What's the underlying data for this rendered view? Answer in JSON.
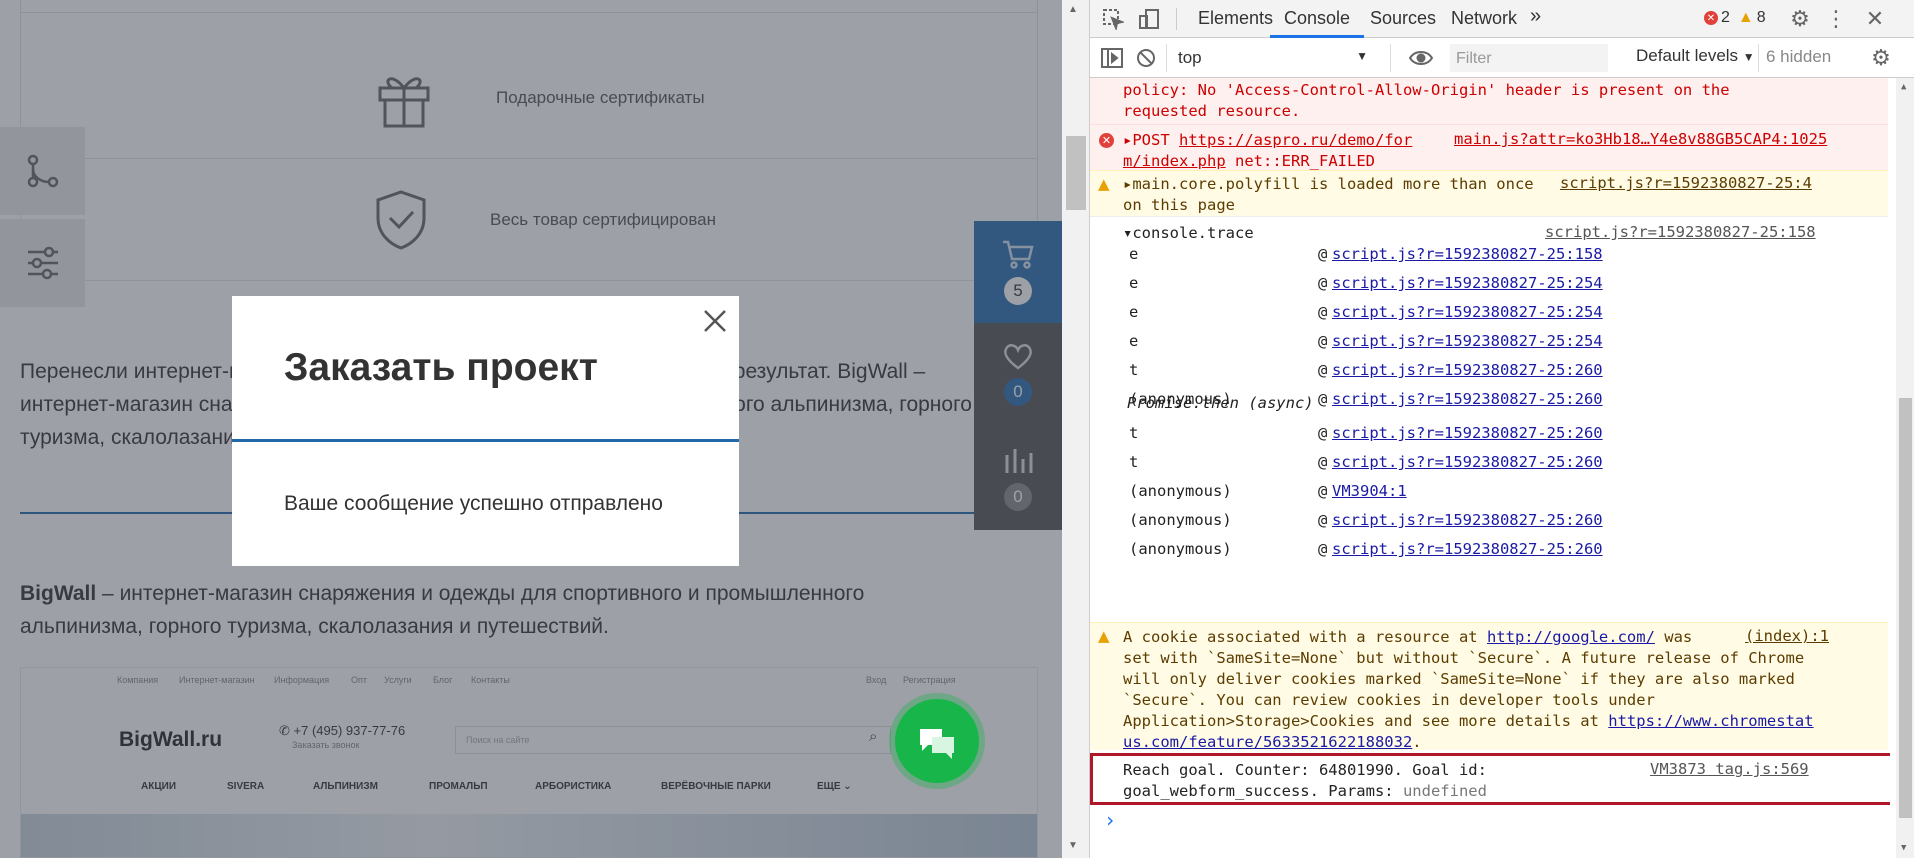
{
  "page": {
    "features": [
      {
        "label": "Подарочные сертификаты",
        "icon": "gift-icon"
      },
      {
        "label": "Весь товар сертифицирован",
        "icon": "shield-check-icon"
      }
    ],
    "intro_text": "Перенесли интернет-магазин на Аспро: Максимум и получили отличный результат. BigWall – интернет-магазин снаряжения и одежды для спортивного и промышленного альпинизма, горного туризма, скалолазания и путешествий.",
    "brand_bold": "BigWall",
    "brand_text": " – интернет-магазин снаряжения и одежды для спортивного и промышленного альпинизма, горного туризма, скалолазания и путешествий.",
    "screenshot": {
      "top_links": [
        "Компания",
        "Интернет-магазин",
        "Информация",
        "Опт",
        "Услуги",
        "Блог",
        "Контакты"
      ],
      "login": "Вход",
      "register": "Регистрация",
      "logo": "BigWall.ru",
      "phone": "+7 (495) 937-77-76",
      "call": "Заказать звонок",
      "search_placeholder": "Поиск на сайте",
      "menu": [
        "АКЦИИ",
        "SIVERA",
        "АЛЬПИНИЗМ",
        "ПРОМАЛЬП",
        "АРБОРИСТИКА",
        "ВЕРЁВОЧНЫЕ ПАРКИ",
        "ЕЩЕ"
      ]
    },
    "cart_count": "5",
    "favorites_count": "0",
    "compare_count": "0"
  },
  "modal": {
    "title": "Заказать проект",
    "message": "Ваше сообщение успешно отправлено"
  },
  "devtools": {
    "tabs": [
      "Elements",
      "Console",
      "Sources",
      "Network"
    ],
    "active_tab": "Console",
    "more_tabs": "»",
    "errors_count": "2",
    "warnings_count": "8",
    "context": "top",
    "filter_placeholder": "Filter",
    "levels": "Default levels",
    "hidden": "6 hidden",
    "messages": {
      "cors_tail": "policy: No 'Access-Control-Allow-Origin' header is present on the\nrequested resource.",
      "post_method": "POST",
      "post_url_1": "https://aspro.ru/demo/for",
      "post_url_2": "m/index.php",
      "post_error": "net::ERR_FAILED",
      "post_source": "main.js?attr=ko3Hb18…Y4e8v88GB5CAP4:1025",
      "polyfill": "main.core.polyfill is loaded more than once\non this page",
      "polyfill_source": "script.js?r=1592380827-25:4",
      "trace_label": "console.trace",
      "trace_source": "script.js?r=1592380827-25:158",
      "frames": [
        {
          "name": "e",
          "link": "script.js?r=1592380827-25:158"
        },
        {
          "name": "e",
          "link": "script.js?r=1592380827-25:254"
        },
        {
          "name": "e",
          "link": "script.js?r=1592380827-25:254"
        },
        {
          "name": "e",
          "link": "script.js?r=1592380827-25:254"
        },
        {
          "name": "t",
          "link": "script.js?r=1592380827-25:260"
        },
        {
          "name": "(anonymous)",
          "link": "script.js?r=1592380827-25:260"
        }
      ],
      "async_label": "Promise.then (async)",
      "frames2": [
        {
          "name": "t",
          "link": "script.js?r=1592380827-25:260"
        },
        {
          "name": "t",
          "link": "script.js?r=1592380827-25:260"
        },
        {
          "name": "(anonymous)",
          "link": "VM3904:1"
        },
        {
          "name": "(anonymous)",
          "link": "script.js?r=1592380827-25:260"
        },
        {
          "name": "(anonymous)",
          "link": "script.js?r=1592380827-25:260"
        }
      ],
      "cookie_1": "A cookie associated with a resource at ",
      "cookie_link": "http://google.com/",
      "cookie_2": " was",
      "cookie_rest": "set with `SameSite=None` but without `Secure`. A future release of Chrome\nwill only deliver cookies marked `SameSite=None` if they are also marked\n`Secure`. You can review cookies in developer tools under\nApplication>Storage>Cookies and see more details at ",
      "cookie_link2a": "https://www.chromestat",
      "cookie_link2b": "us.com/feature/5633521622188032",
      "cookie_source": "(index):1",
      "goal_1": "Reach goal. Counter: 64801990. Goal id:",
      "goal_2": "goal_webform_success. Params: ",
      "goal_undefined": "undefined",
      "goal_source": "VM3873 tag.js:569",
      "prompt": "›"
    }
  }
}
